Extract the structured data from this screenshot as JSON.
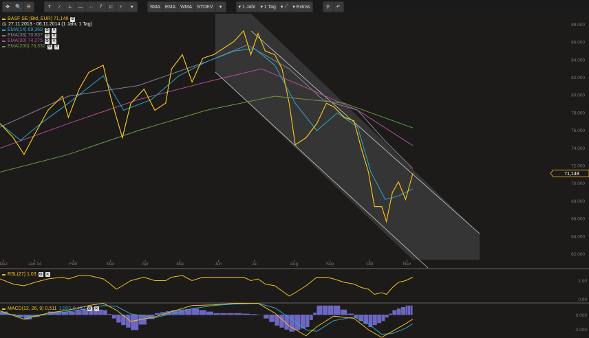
{
  "toolbar": {
    "nav": [
      "✥",
      "🔍",
      "☰"
    ],
    "draw": [
      "T",
      "⁄",
      "Ⲳ",
      "—",
      "···",
      "⫽",
      "⊏",
      "⊦",
      "▾"
    ],
    "indicators": [
      "SMA",
      "EMA",
      "WMA",
      "STDEV"
    ],
    "period": "1 Jahr",
    "interval": "1 Tag",
    "chart_type": "⟋",
    "extras": "Extras",
    "zoom": [
      "⚲",
      "↶"
    ]
  },
  "legend": {
    "main": "BASF SE (Bid, EUR)  71,148",
    "range": "27.11.2013 - 06.11.2014 (1 Jahr, 1 Tag)",
    "ema14": "EMA(14)  69,369",
    "ema38": "EMA(38)  70,837",
    "ema90": "EMA(90)  74,275",
    "ema200": "EMA(200)  76,332"
  },
  "colors": {
    "price": "#f2c01a",
    "ema14": "#2aa7c9",
    "ema38": "#8a8095",
    "ema90": "#b0509a",
    "ema200": "#6f9a45"
  },
  "rsl": {
    "label": "RSL(27)  1,03",
    "ticks": [
      "1,00",
      "0,90"
    ]
  },
  "macd": {
    "label": "MACD(12, 26, 9)  0,511",
    "v2": "1,003",
    "v3": "0,492",
    "ticks": [
      "0.000",
      "-2.000"
    ]
  },
  "chart_data": {
    "type": "line",
    "title": "BASF SE (Bid, EUR)",
    "last_value": "71,148",
    "ylim": [
      61,
      89
    ],
    "yticks": [
      "88.000",
      "86.000",
      "84.000",
      "82.000",
      "80.000",
      "78.000",
      "76.000",
      "74.000",
      "72.000",
      "70.000",
      "68.000",
      "66.000",
      "64.000",
      "62.000"
    ],
    "xticks": [
      "Dez",
      "Jan 14",
      "Feb",
      "Mar",
      "Apr",
      "Mai",
      "Jun",
      "Jul",
      "Aug",
      "Sep",
      "Okt",
      "Nov"
    ],
    "xtick_days": [
      3,
      29,
      61,
      92,
      121,
      150,
      182,
      212,
      245,
      275,
      308,
      339
    ],
    "series": [
      {
        "name": "Price",
        "x": [
          0,
          11,
          20,
          29,
          40,
          52,
          57,
          66,
          74,
          86,
          92,
          97,
          102,
          109,
          120,
          129,
          138,
          143,
          152,
          160,
          169,
          178,
          186,
          195,
          203,
          209,
          215,
          221,
          229,
          235,
          241,
          246,
          255,
          264,
          272,
          278,
          287,
          295,
          301,
          307,
          312,
          318,
          322,
          327,
          332,
          338,
          344
        ],
        "y": [
          76.8,
          75.2,
          73.3,
          75.6,
          78.3,
          79.9,
          77.5,
          80.7,
          82.6,
          83.4,
          79.9,
          77.5,
          75.2,
          79.1,
          80.7,
          78.3,
          79.1,
          83,
          84.6,
          81.5,
          84.2,
          84.6,
          85.3,
          86.1,
          87.3,
          84.6,
          87,
          85,
          84.6,
          83,
          79.1,
          74.4,
          75.2,
          76.8,
          79.1,
          78.7,
          77.5,
          77.1,
          74,
          71.3,
          67.4,
          67.4,
          65.7,
          69,
          70.2,
          68.2,
          71.15
        ]
      },
      {
        "name": "EMA(14)",
        "x": [
          0,
          17,
          34,
          57,
          86,
          103,
          126,
          149,
          172,
          195,
          212,
          229,
          246,
          264,
          281,
          298,
          309,
          321,
          332,
          344
        ],
        "y": [
          76.8,
          74.9,
          76.8,
          79.1,
          82.2,
          78.3,
          79.5,
          82.2,
          83.8,
          85,
          85.3,
          83.4,
          79.1,
          76,
          78,
          76.4,
          71.3,
          68.2,
          68.6,
          69.4
        ]
      },
      {
        "name": "EMA(38)",
        "x": [
          0,
          57,
          115,
          172,
          206,
          241,
          269,
          298,
          321,
          344
        ],
        "y": [
          76.4,
          79.9,
          81.1,
          83.8,
          85.7,
          83,
          79.5,
          78.3,
          74.8,
          71.7
        ]
      },
      {
        "name": "EMA(90)",
        "x": [
          0,
          57,
          115,
          172,
          218,
          258,
          298,
          344
        ],
        "y": [
          74,
          76.8,
          79.5,
          81.5,
          83,
          80.7,
          78.3,
          74.3
        ]
      },
      {
        "name": "EMA(200)",
        "x": [
          0,
          57,
          115,
          172,
          229,
          287,
          344
        ],
        "y": [
          71.3,
          73.3,
          76,
          78.3,
          79.9,
          79.1,
          76.3
        ]
      }
    ]
  },
  "rsl_data": {
    "x": [
      0,
      11,
      20,
      29,
      40,
      52,
      57,
      66,
      74,
      86,
      92,
      97,
      102,
      109,
      120,
      129,
      138,
      143,
      152,
      160,
      169,
      178,
      186,
      195,
      203,
      209,
      215,
      221,
      229,
      235,
      241,
      246,
      255,
      264,
      272,
      278,
      287,
      295,
      301,
      307,
      312,
      318,
      322,
      327,
      332,
      338,
      344
    ],
    "y": [
      1.02,
      0.99,
      0.98,
      1.0,
      1.02,
      1.03,
      1.02,
      1.04,
      1.04,
      1.02,
      0.99,
      0.96,
      0.98,
      1.01,
      1.03,
      1.01,
      1.01,
      1.03,
      1.04,
      1.01,
      1.03,
      1.03,
      1.03,
      1.03,
      1.03,
      1.01,
      1.02,
      0.99,
      0.98,
      0.95,
      0.92,
      0.94,
      0.98,
      1.03,
      1.03,
      1.02,
      1.0,
      0.99,
      0.97,
      0.96,
      0.93,
      0.94,
      0.93,
      0.97,
      1.0,
      1.01,
      1.03
    ],
    "ylim": [
      0.9,
      1.06
    ]
  },
  "macd_data": {
    "x": [
      0,
      20,
      40,
      57,
      74,
      86,
      97,
      109,
      129,
      143,
      160,
      178,
      195,
      215,
      229,
      241,
      255,
      264,
      278,
      295,
      307,
      318,
      327,
      338,
      344
    ],
    "macd": [
      0.5,
      -0.6,
      0.2,
      0.6,
      1.2,
      1.5,
      0.6,
      -0.9,
      -0.3,
      0.4,
      1.2,
      1.3,
      1.5,
      1.5,
      0.2,
      -1.5,
      -2.8,
      -1.6,
      -0.2,
      -0.5,
      -2.0,
      -3.0,
      -2.2,
      -1.2,
      -0.6
    ],
    "signal": [
      0.3,
      -0.3,
      0,
      0.4,
      0.8,
      1.2,
      1.1,
      0.1,
      -0.4,
      0.1,
      0.8,
      1.2,
      1.4,
      1.5,
      0.9,
      -0.4,
      -2.0,
      -2.2,
      -0.8,
      -0.3,
      -1.2,
      -2.6,
      -2.5,
      -1.8,
      -1.2
    ],
    "ylim": [
      -3.3,
      2.2
    ]
  }
}
